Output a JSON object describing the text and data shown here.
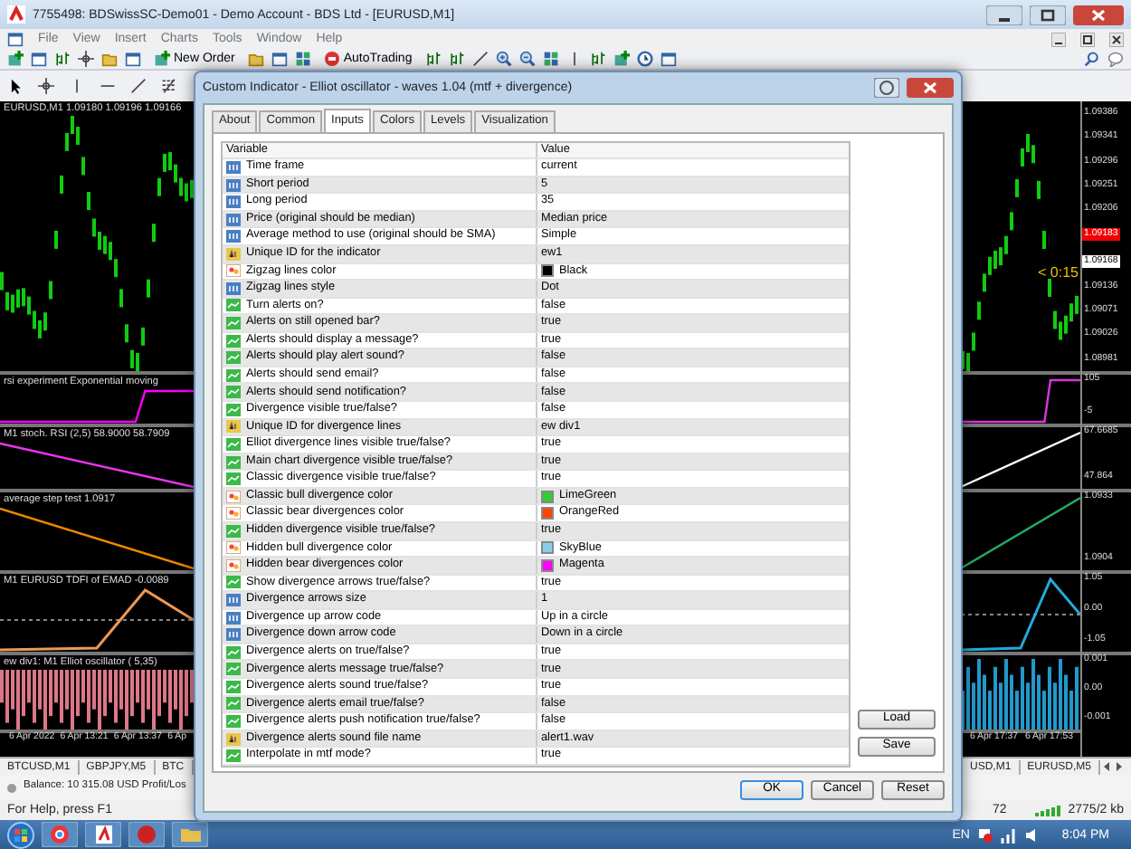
{
  "app_window": {
    "title": "7755498: BDSwissSC-Demo01 - Demo Account - BDS Ltd - [EURUSD,M1]"
  },
  "menu": [
    "File",
    "View",
    "Insert",
    "Charts",
    "Tools",
    "Window",
    "Help"
  ],
  "toolbar": {
    "new_order": "New Order",
    "auto_trading": "AutoTrading"
  },
  "chart": {
    "symbol_label": "EURUSD,M1 1.09180 1.09196 1.09166",
    "price_axis": [
      {
        "kind": "tick",
        "text": "1.09386"
      },
      {
        "kind": "tick",
        "text": "1.09341"
      },
      {
        "kind": "tick",
        "text": "1.09296"
      },
      {
        "kind": "tick",
        "text": "1.09251"
      },
      {
        "kind": "tick",
        "text": "1.09206"
      },
      {
        "kind": "bid",
        "text": "1.09183"
      },
      {
        "kind": "ask",
        "text": "1.09168"
      },
      {
        "kind": "tick",
        "text": "1.09136"
      },
      {
        "kind": "tick",
        "text": "1.09071"
      },
      {
        "kind": "tick",
        "text": "1.09026"
      },
      {
        "kind": "tick",
        "text": "1.08981"
      }
    ],
    "timer": "< 0:15",
    "subwindows": [
      {
        "label": "rsi experiment Exponential moving",
        "axis": [
          "105",
          "-5"
        ]
      },
      {
        "label": "M1 stoch. RSI (2,5) 58.9000 58.7909",
        "axis": [
          "67.6685",
          "47.864"
        ]
      },
      {
        "label": "average step test 1.0917",
        "axis": [
          "1.0933",
          "1.0904"
        ]
      },
      {
        "label": "M1 EURUSD TDFI of EMAD -0.0089",
        "axis": [
          "1.05",
          "0.00",
          "-1.05"
        ]
      },
      {
        "label": "ew div1: M1 Elliot oscillator ( 5,35)",
        "axis": [
          "0.001",
          "0.00",
          "-0.001"
        ]
      }
    ],
    "time_axis_left": [
      "6 Apr 2022",
      "6 Apr 13:21",
      "6 Apr 13:37",
      "6 Ap"
    ],
    "time_axis_right": [
      "6 Apr 17:37",
      "6 Apr 17:53"
    ]
  },
  "chart_tabs_left": [
    "BTCUSD,M1",
    "GBPJPY,M5",
    "BTC"
  ],
  "chart_tabs_right": [
    "USD,M1",
    "EURUSD,M5"
  ],
  "terminal": {
    "balance": "Balance: 10 315.08 USD Profit/Los"
  },
  "status_bar": {
    "help": "For Help, press F1",
    "bars": "72",
    "traffic": "2775/2 kb"
  },
  "taskbar": {
    "language": "EN",
    "clock": "8:04 PM"
  },
  "dialog": {
    "title": "Custom Indicator - Elliot oscillator - waves 1.04 (mtf + divergence)",
    "tabs": [
      {
        "label": "About",
        "selected": false
      },
      {
        "label": "Common",
        "selected": false
      },
      {
        "label": "Inputs",
        "selected": true
      },
      {
        "label": "Colors",
        "selected": false
      },
      {
        "label": "Levels",
        "selected": false
      },
      {
        "label": "Visualization",
        "selected": false
      }
    ],
    "columns": [
      "Variable",
      "Value"
    ],
    "rows": [
      {
        "kind": "int",
        "variable": "Time frame",
        "value": "current"
      },
      {
        "kind": "int",
        "variable": "Short period",
        "value": "5"
      },
      {
        "kind": "int",
        "variable": "Long period",
        "value": "35"
      },
      {
        "kind": "int",
        "variable": "Price (original should be median)",
        "value": "Median price"
      },
      {
        "kind": "int",
        "variable": "Average method to use (original should be SMA)",
        "value": "Simple"
      },
      {
        "kind": "string",
        "variable": "Unique ID for the indicator",
        "value": "ew1"
      },
      {
        "kind": "color",
        "variable": "Zigzag lines color",
        "value": "Black",
        "color": "#000000"
      },
      {
        "kind": "int",
        "variable": "Zigzag lines style",
        "value": "Dot"
      },
      {
        "kind": "bool",
        "variable": "Turn alerts on?",
        "value": "false"
      },
      {
        "kind": "bool",
        "variable": "Alerts on still opened bar?",
        "value": "true"
      },
      {
        "kind": "bool",
        "variable": "Alerts should display a message?",
        "value": "true"
      },
      {
        "kind": "bool",
        "variable": "Alerts should play alert sound?",
        "value": "false"
      },
      {
        "kind": "bool",
        "variable": "Alerts should send email?",
        "value": "false"
      },
      {
        "kind": "bool",
        "variable": "Alerts should send notification?",
        "value": "false"
      },
      {
        "kind": "bool",
        "variable": "Divergence visible true/false?",
        "value": "false"
      },
      {
        "kind": "string",
        "variable": "Unique ID for divergence lines",
        "value": "ew div1"
      },
      {
        "kind": "bool",
        "variable": "Elliot divergence lines visible true/false?",
        "value": "true"
      },
      {
        "kind": "bool",
        "variable": "Main chart divergence visible true/false?",
        "value": "true"
      },
      {
        "kind": "bool",
        "variable": "Classic divergence visible true/false?",
        "value": "true"
      },
      {
        "kind": "color",
        "variable": "Classic bull divergence color",
        "value": "LimeGreen",
        "color": "#32cd32"
      },
      {
        "kind": "color",
        "variable": "Classic bear divergences color",
        "value": "OrangeRed",
        "color": "#ff4500"
      },
      {
        "kind": "bool",
        "variable": "Hidden divergence visible true/false?",
        "value": "true"
      },
      {
        "kind": "color",
        "variable": "Hidden bull divergence color",
        "value": "SkyBlue",
        "color": "#87ceeb"
      },
      {
        "kind": "color",
        "variable": "Hidden bear divergences color",
        "value": "Magenta",
        "color": "#ff00ff"
      },
      {
        "kind": "bool",
        "variable": "Show divergence arrows true/false?",
        "value": "true"
      },
      {
        "kind": "int",
        "variable": "Divergence arrows size",
        "value": "1"
      },
      {
        "kind": "int",
        "variable": "Divergence up arrow code",
        "value": "Up in a circle"
      },
      {
        "kind": "int",
        "variable": "Divergence down arrow code",
        "value": "Down in a circle"
      },
      {
        "kind": "bool",
        "variable": "Divergence alerts on true/false?",
        "value": "true"
      },
      {
        "kind": "bool",
        "variable": "Divergence alerts message true/false?",
        "value": "true"
      },
      {
        "kind": "bool",
        "variable": "Divergence alerts sound true/false?",
        "value": "true"
      },
      {
        "kind": "bool",
        "variable": "Divergence alerts email true/false?",
        "value": "false"
      },
      {
        "kind": "bool",
        "variable": "Divergence alerts push notification true/false?",
        "value": "false"
      },
      {
        "kind": "string",
        "variable": "Divergence alerts sound file name",
        "value": "alert1.wav"
      },
      {
        "kind": "bool",
        "variable": "Interpolate in mtf mode?",
        "value": "true"
      }
    ],
    "side_buttons": [
      "Load",
      "Save"
    ],
    "buttons": [
      "OK",
      "Cancel",
      "Reset"
    ]
  }
}
